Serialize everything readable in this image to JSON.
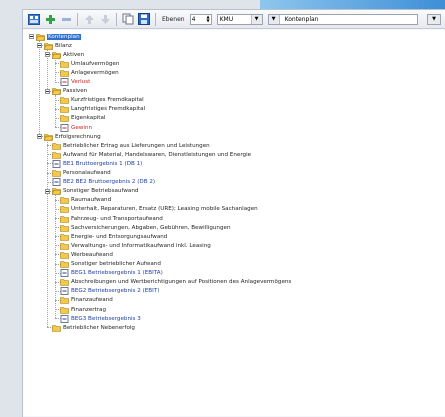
{
  "colors": {
    "selection": "#2f6fd0",
    "folder": "#f2c94c",
    "loss_red": "#d02020",
    "result_blue": "#1f3ea8"
  },
  "toolbar": {
    "levels_label": "Ebenen",
    "levels_value": "4",
    "scheme_value": "KMU",
    "plan_value": "Kontenplan",
    "icons": [
      "grid-icon",
      "plus-icon",
      "minus-icon",
      "up-icon",
      "down-icon",
      "copy-icon",
      "save-icon"
    ]
  },
  "tree": [
    {
      "label": "Kontenplan",
      "level": 0,
      "icon": "folder-open",
      "style": "sel"
    },
    {
      "label": "Bilanz",
      "level": 1,
      "icon": "folder-open"
    },
    {
      "label": "Aktiven",
      "level": 2,
      "icon": "folder-open"
    },
    {
      "label": "Umlaufvermögen",
      "level": 3,
      "icon": "folder"
    },
    {
      "label": "Anlagevermögen",
      "level": 3,
      "icon": "folder"
    },
    {
      "label": "Verlust",
      "level": 3,
      "icon": "result",
      "style": "red"
    },
    {
      "label": "Passiven",
      "level": 2,
      "icon": "folder-open"
    },
    {
      "label": "Kurzfristiges Fremdkapital",
      "level": 3,
      "icon": "folder"
    },
    {
      "label": "Langfristiges Fremdkapital",
      "level": 3,
      "icon": "folder"
    },
    {
      "label": "Eigenkapital",
      "level": 3,
      "icon": "folder"
    },
    {
      "label": "Gewinn",
      "level": 3,
      "icon": "result",
      "style": "red"
    },
    {
      "label": "Erfolgsrechnung",
      "level": 1,
      "icon": "folder-open"
    },
    {
      "label": "Betrieblicher Ertrag aus Lieferungen und Leistungen",
      "level": 2,
      "icon": "folder"
    },
    {
      "label": "Aufwand für Material, Handelswaren, Dienstleistungen und Energie",
      "level": 2,
      "icon": "folder"
    },
    {
      "label": "BE1 Bruttoergebnis 1 (DB 1)",
      "level": 2,
      "icon": "result",
      "style": "blue"
    },
    {
      "label": "Personalaufwand",
      "level": 2,
      "icon": "folder"
    },
    {
      "label": "BE2 BE2 Bruttoergebnis 2 (DB 2)",
      "level": 2,
      "icon": "result",
      "style": "blue"
    },
    {
      "label": "Sonstiger Betriebsaufwand",
      "level": 2,
      "icon": "folder-open"
    },
    {
      "label": "Raumaufwand",
      "level": 3,
      "icon": "folder"
    },
    {
      "label": "Unterhalt, Reparaturen, Ersatz (URE); Leasing mobile Sachanlagen",
      "level": 3,
      "icon": "folder"
    },
    {
      "label": "Fahrzeug- und Transportaufwand",
      "level": 3,
      "icon": "folder"
    },
    {
      "label": "Sachversicherungen, Abgaben, Gebühren, Bewilligungen",
      "level": 3,
      "icon": "folder"
    },
    {
      "label": "Energie- und Entsorgungsaufwand",
      "level": 3,
      "icon": "folder"
    },
    {
      "label": "Verwaltungs- und Informatikaufwand inkl. Leasing",
      "level": 3,
      "icon": "folder"
    },
    {
      "label": "Werbeaufwand",
      "level": 3,
      "icon": "folder"
    },
    {
      "label": "Sonstiger betrieblicher Aufwand",
      "level": 3,
      "icon": "folder"
    },
    {
      "label": "BEG1 Betriebsergebnis 1 (EBITA)",
      "level": 3,
      "icon": "result",
      "style": "blue"
    },
    {
      "label": "Abschreibungen und Wertberichtigungen auf Positionen des Anlagevermögens",
      "level": 3,
      "icon": "folder"
    },
    {
      "label": "BEG2 Betriebsergebnis 2 (EBIT)",
      "level": 3,
      "icon": "result",
      "style": "blue"
    },
    {
      "label": "Finanzaufwand",
      "level": 3,
      "icon": "folder"
    },
    {
      "label": "Finanzertrag",
      "level": 3,
      "icon": "folder"
    },
    {
      "label": "BEG3 Betriebsergebnis 3",
      "level": 3,
      "icon": "result",
      "style": "blue"
    },
    {
      "label": "Betrieblicher Nebenerfolg",
      "level": 2,
      "icon": "folder"
    }
  ]
}
